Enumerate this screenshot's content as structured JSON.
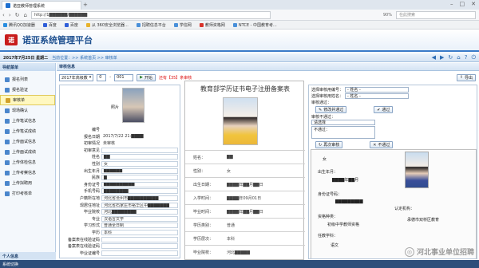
{
  "browser": {
    "tab_title": "诺亚教师管理系统",
    "new_tab": "+",
    "url": "http://1▇▇▇▇▇▇/▇▇▇▇▇▇",
    "zoom": "90%",
    "search_placeholder": "在此搜索",
    "win_controls": [
      "–",
      "□",
      "✕"
    ]
  },
  "bookmarks": [
    "腾讯QQ加速器",
    "百度",
    "百度",
    "从 360安全浏览器...",
    "招聘信息平台",
    "学信网",
    "教师资格网",
    "NTCE - 中国教育考..."
  ],
  "app": {
    "logo": "诺",
    "title": "诺亚系统管理平台"
  },
  "crumb": {
    "date": "2017年7月25日 星期二",
    "location": "当前位置：>> 系统首页 >> 审核单"
  },
  "sidebar": {
    "header": "导航菜单",
    "items": [
      "报名列表",
      "报名验证",
      "审核单",
      "现场确认",
      "上传笔试信息",
      "上传笔试成绩",
      "上传面试信息",
      "上传面试成绩",
      "上传体检信息",
      "上传考察信息",
      "上传拟聘用",
      "打印考核单"
    ],
    "personal": "个人信息",
    "bottom": "系统切换"
  },
  "main": {
    "header": "审核信息",
    "year": "2017年高级教",
    "page": "0",
    "sep": "-",
    "page2": "001",
    "go": "开始",
    "warning": "还有【35】条审核",
    "export": "导出"
  },
  "record": {
    "photo_label": "照片",
    "fields": [
      {
        "k": "编号",
        "v": ""
      },
      {
        "k": "报名日期",
        "v": "2017/7/22 21:▇▇▇▇"
      },
      {
        "k": "初审情况",
        "v": "未审核"
      },
      {
        "k": "初审意见",
        "v": ""
      },
      {
        "k": "姓名",
        "v": "▇▇"
      },
      {
        "k": "性别",
        "v": "女"
      },
      {
        "k": "出生年月",
        "v": "▇▇▇▇▇▇"
      },
      {
        "k": "民族",
        "v": "▇"
      },
      {
        "k": "身份证号",
        "v": "▇▇▇▇▇▇▇▇▇▇"
      },
      {
        "k": "手机号码",
        "v": "▇▇▇▇▇▇▇▇"
      },
      {
        "k": "户籍所在地",
        "v": "河北省沧州市▇▇▇▇▇▇▇▇▇▇"
      },
      {
        "k": "现居住地址",
        "v": "河北省石家庄市裕华区中▇▇▇▇▇▇▇"
      },
      {
        "k": "毕业院校",
        "v": "河北▇▇▇▇▇▇▇▇"
      },
      {
        "k": "专业",
        "v": "汉语言文学"
      },
      {
        "k": "学习形式",
        "v": "普通全日制"
      },
      {
        "k": "学历",
        "v": "本科"
      },
      {
        "k": "备案表在线验证码",
        "v": ""
      },
      {
        "k": "备案表在线验证码",
        "v": ""
      },
      {
        "k": "毕业证编号",
        "v": ""
      }
    ]
  },
  "cert": {
    "title": "教育部学历证书电子注册备案表",
    "rows": [
      {
        "k": "姓名：",
        "v": "▇▇"
      },
      {
        "k": "性别：",
        "v": "女"
      },
      {
        "k": "出生日期：",
        "v": "▇▇▇▇年▇▇月▇▇日"
      },
      {
        "k": "入学时间：",
        "v": "▇▇▇▇年09月01日"
      },
      {
        "k": "毕业时间：",
        "v": "▇▇▇▇年▇▇月▇▇日"
      },
      {
        "k": "学历类别：",
        "v": "普通"
      },
      {
        "k": "学历层次：",
        "v": "本科"
      },
      {
        "k": "毕业院校：",
        "v": "河北▇▇▇▇▇"
      }
    ]
  },
  "review": {
    "opt1_label": "选择审核用编号：",
    "opt1_value": "- 姓名 -",
    "opt2_label": "选择审核用姓名：",
    "opt2_value": "- 姓名 -",
    "pass_label": "审核通过：",
    "pass_btn": "修改并通过",
    "pass_btn2": "通过",
    "fail_label": "审核不通过：",
    "fail_select": "请选择",
    "reason_placeholder": "不通过：",
    "retry_btn": "再次审核",
    "fail_btn": "不通过"
  },
  "certimg": {
    "gender": "女",
    "birth": "出生年月：",
    "birth_v": "▇▇▇▇年▇▇月",
    "id_label": "身份证号码：",
    "id_v": "▇▇▇▇▇▇▇▇▇",
    "qual_label": "资格种类：",
    "qual_v": "初级中学教师资格",
    "subject_label": "任教学科：",
    "subject_v": "语文",
    "org_label": "认定机构：",
    "org_v": "承德市双桥区教育"
  },
  "watermark": {
    "logo": "◎",
    "text": "河北事业单位招聘"
  }
}
